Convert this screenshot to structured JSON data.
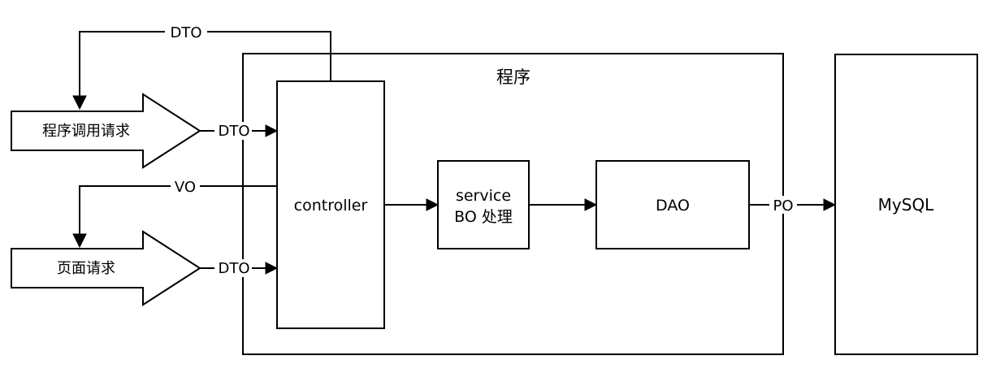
{
  "diagram": {
    "program_container_label": "程序",
    "nodes": {
      "program_call_request": "程序调用请求",
      "page_request": "页面请求",
      "controller": "controller",
      "service_line1": "service",
      "service_line2": "BO 处理",
      "dao": "DAO",
      "mysql": "MySQL"
    },
    "edge_labels": {
      "dto_return": "DTO",
      "dto_program_call": "DTO",
      "vo_return": "VO",
      "dto_page": "DTO",
      "po": "PO"
    }
  }
}
